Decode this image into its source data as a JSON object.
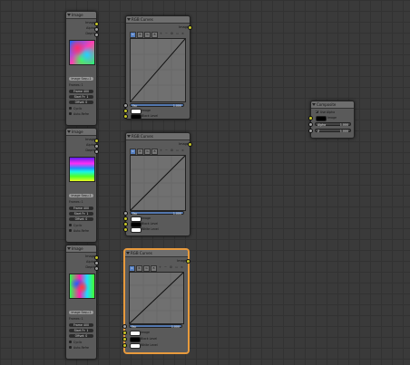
{
  "image_nodes": [
    {
      "title": "Image",
      "outputs": [
        "Image",
        "Alpha",
        "Depth"
      ],
      "image_name": "Image Sequ.1",
      "frames": "Frames: 1",
      "fields": [
        "Frame 400",
        "Start Fr: 1",
        "Offset: 0"
      ],
      "cyclic": "Cyclic",
      "auto_refresh": "Auto-Refre"
    },
    {
      "title": "Image",
      "outputs": [
        "Image",
        "Alpha",
        "Depth"
      ],
      "image_name": "Image Sequ.1",
      "frames": "Frames: 1",
      "fields": [
        "Frame 400",
        "Start Fr: 1",
        "Offset: 0"
      ],
      "cyclic": "Cyclic",
      "auto_refresh": "Auto-Refre"
    },
    {
      "title": "Image",
      "outputs": [
        "Image",
        "Alpha",
        "Depth"
      ],
      "image_name": "Image Sequ.1",
      "frames": "Frames: 1",
      "fields": [
        "Frame 400",
        "Start Fr: 1",
        "Offset: 0"
      ],
      "cyclic": "Cyclic",
      "auto_refresh": "Auto-Refre"
    }
  ],
  "curve_nodes": [
    {
      "title": "RGB Curves",
      "output": "Image",
      "channels": [
        "C",
        "R",
        "G",
        "B"
      ],
      "fac_label": "Fac",
      "fac_value": "1.000",
      "inputs": [
        "Image",
        "Black Level",
        "White Level"
      ]
    },
    {
      "title": "RGB Curves",
      "output": "Image",
      "channels": [
        "C",
        "R",
        "G",
        "B"
      ],
      "fac_label": "Fac",
      "fac_value": "1.000",
      "inputs": [
        "Image",
        "Black Level",
        "White Level"
      ]
    },
    {
      "title": "RGB Curves",
      "output": "Image",
      "channels": [
        "C",
        "R",
        "G",
        "B"
      ],
      "fac_label": "Fac",
      "fac_value": "1.000",
      "inputs": [
        "Image",
        "Black Level",
        "White Level"
      ]
    }
  ],
  "composite_node": {
    "title": "Composite",
    "use_alpha": "Use Alpha",
    "input_image": "Image",
    "alpha_label": "Alpha",
    "alpha_value": "1.000",
    "z_label": "Z",
    "z_value": "1.000"
  },
  "colors": {
    "active_outline": "#e89a3c",
    "image_socket": "#c7c729",
    "value_socket": "#a1a1a1",
    "node_body": "#5a5a5a",
    "grid_bg": "#3a3a3a"
  }
}
